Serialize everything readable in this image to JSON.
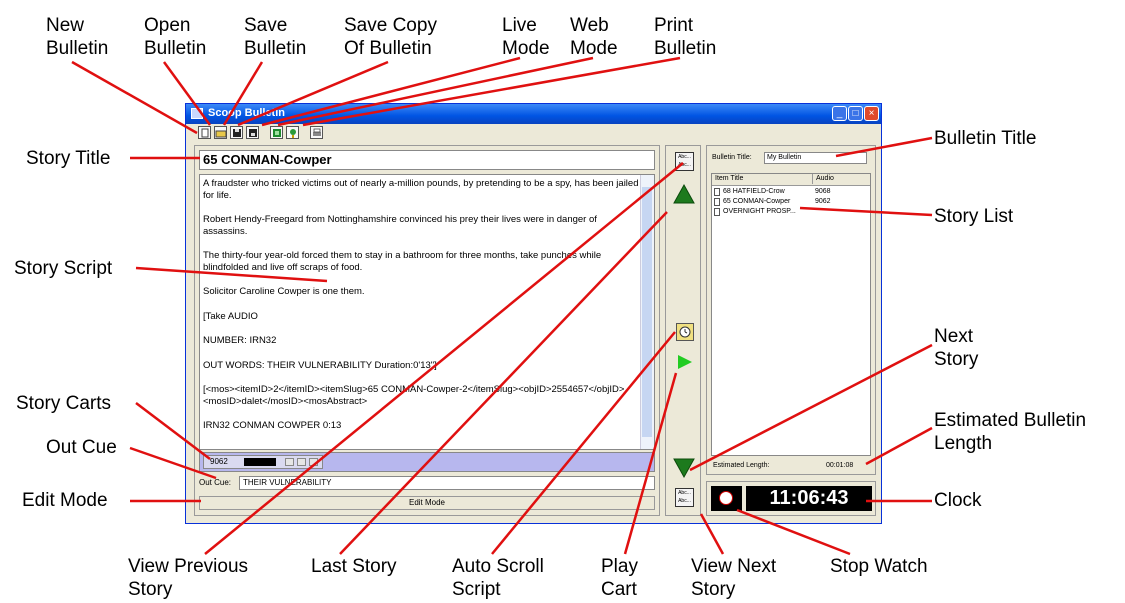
{
  "callouts": {
    "new_bulletin": "New\nBulletin",
    "open_bulletin": "Open\nBulletin",
    "save_bulletin": "Save\nBulletin",
    "save_copy": "Save Copy\nOf Bulletin",
    "live_mode": "Live\nMode",
    "web_mode": "Web\nMode",
    "print_bulletin": "Print\nBulletin",
    "story_title": "Story Title",
    "story_script": "Story Script",
    "story_carts": "Story Carts",
    "out_cue": "Out Cue",
    "edit_mode": "Edit Mode",
    "view_previous_story": "View Previous\nStory",
    "last_story": "Last Story",
    "auto_scroll_script": "Auto Scroll\nScript",
    "play_cart": "Play\nCart",
    "view_next_story": "View Next\nStory",
    "stop_watch": "Stop Watch",
    "bulletin_title": "Bulletin Title",
    "story_list": "Story List",
    "next_story": "Next\nStory",
    "estimated_bulletin_length": "Estimated Bulletin\nLength",
    "clock": "Clock"
  },
  "window": {
    "title": "Scoop Bulletin",
    "min_glyph": "_",
    "max_glyph": "□",
    "close_glyph": "×"
  },
  "story": {
    "title": "65 CONMAN-Cowper",
    "paragraphs": [
      "A fraudster who tricked victims out of nearly a-million pounds, by pretending to be a spy, has been jailed for life.",
      "Robert Hendy-Freegard from Nottinghamshire convinced his prey their lives were in danger of assassins.",
      "The thirty-four year-old forced them to stay in a bathroom for three months, take punches while blindfolded and live off scraps of food.",
      "Solicitor Caroline Cowper is one them.",
      "[Take AUDIO",
      "NUMBER: IRN32",
      "OUT WORDS: THEIR VULNERABILITY Duration:0'13\"]",
      "[<mos><itemID>2</itemID><itemSlug>65 CONMAN-Cowper-2</itemSlug><objID>2554657</objID><mosID>dalet</mosID><mosAbstract>",
      "IRN32 CONMAN COWPER 0:13"
    ],
    "cart_id": "9062",
    "out_cue_label": "Out Cue:",
    "out_cue_value": "THEIR VULNERABILITY",
    "edit_mode_label": "Edit Mode"
  },
  "nav": {
    "abc_label": "Abc... Abc..."
  },
  "bulletin": {
    "title_label": "Bulletin Title:",
    "title_value": "My Bulletin",
    "columns": [
      "Item Title",
      "Audio"
    ],
    "items": [
      {
        "title": "68 HATFIELD-Crow",
        "audio": "9068"
      },
      {
        "title": "65 CONMAN-Cowper",
        "audio": "9062"
      },
      {
        "title": "OVERNIGHT PROSP...",
        "audio": ""
      }
    ],
    "estimated_label": "Estimated Length:",
    "estimated_value": "00:01:08"
  },
  "clock": {
    "time": "11:06:43"
  },
  "colors": {
    "arrow_green": "#1d7a1d",
    "play_green": "#22cc22",
    "callout_red": "#e01010",
    "cart_bar": "#b7b7ee"
  }
}
